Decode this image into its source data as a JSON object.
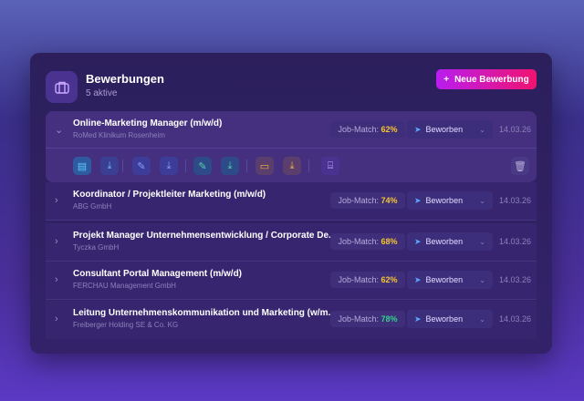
{
  "header": {
    "title": "Bewerbungen",
    "subtitle": "5 aktive",
    "new_button": "Neue Bewerbung",
    "icon": "briefcase-icon"
  },
  "colors": {
    "accent_start": "#b91df0",
    "accent_end": "#f0136f",
    "match_yellow": "#f5c431",
    "match_green": "#2fd48a"
  },
  "match_label": "Job-Match:",
  "applications": [
    {
      "title": "Online-Marketing Manager (m/w/d)",
      "company": "RoMed Klinikum Rosenheim",
      "match": "62%",
      "status": "Beworben",
      "date": "14.03.26",
      "expanded": true
    },
    {
      "title": "Koordinator / Projektleiter Marketing (m/w/d)",
      "company": "ABG GmbH",
      "match": "74%",
      "status": "Beworben",
      "date": "14.03.26",
      "expanded": false
    },
    {
      "title": "Projekt Manager Unternehmensentwicklung / Corporate De...",
      "company": "Tyczka GmbH",
      "match": "68%",
      "status": "Beworben",
      "date": "14.03.26",
      "expanded": false
    },
    {
      "title": "Consultant Portal Management (m/w/d)",
      "company": "FERCHAU Management GmbH",
      "match": "62%",
      "status": "Beworben",
      "date": "14.03.26",
      "expanded": false
    },
    {
      "title": "Leitung Unternehmenskommunikation und Marketing (w/m...",
      "company": "Freiberger Holding SE & Co. KG",
      "match": "78%",
      "status": "Beworben",
      "date": "14.03.26",
      "expanded": false
    }
  ],
  "actions": [
    "document-icon",
    "download-icon",
    "pencil-icon",
    "download-icon",
    "pencil-icon",
    "download-icon",
    "chat-icon",
    "download-icon",
    "briefcase-icon",
    "trash-icon"
  ]
}
